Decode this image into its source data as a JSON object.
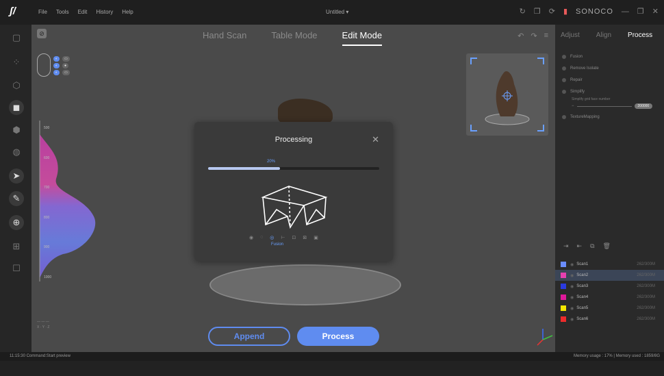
{
  "app": {
    "menu": [
      "File",
      "Tools",
      "Edit",
      "History",
      "Help"
    ],
    "document_title": "Untitled",
    "brand": "SONOCO"
  },
  "modes": {
    "items": [
      "Hand Scan",
      "Table Mode",
      "Edit Mode"
    ],
    "active": "Edit Mode"
  },
  "dialog": {
    "title": "Processing",
    "progress_label": "20%",
    "progress": 0.42,
    "current_step": "Fusion"
  },
  "buttons": {
    "append": "Append",
    "process": "Process"
  },
  "panel": {
    "tabs": [
      "Adjust",
      "Align",
      "Process"
    ],
    "active_tab": "Process",
    "process_steps": [
      "Fusion",
      "Remove Isolate",
      "Repair",
      "Simplify",
      "TextureMapping"
    ],
    "simplify_label": "Simplify grid face number",
    "simplify_value": "200000"
  },
  "scans": [
    {
      "name": "Scan1",
      "color": "#6a8cff",
      "size": "262/300M"
    },
    {
      "name": "Scan2",
      "color": "#e53fb0",
      "size": "262/300M"
    },
    {
      "name": "Scan3",
      "color": "#2a3ae0",
      "size": "262/300M"
    },
    {
      "name": "Scan4",
      "color": "#e0199a",
      "size": "262/300M"
    },
    {
      "name": "Scan5",
      "color": "#f2e600",
      "size": "262/300M"
    },
    {
      "name": "Scan6",
      "color": "#ee2b2b",
      "size": "262/300M"
    }
  ],
  "histogram_labels": [
    "500",
    "600",
    "700",
    "800",
    "900",
    "1000"
  ],
  "status": {
    "left": "11:15:30 Command:Start preview",
    "right": "Memory usage : 17% | Memory used : 1859/8G"
  },
  "colors": {
    "accent": "#5f8cf0"
  }
}
